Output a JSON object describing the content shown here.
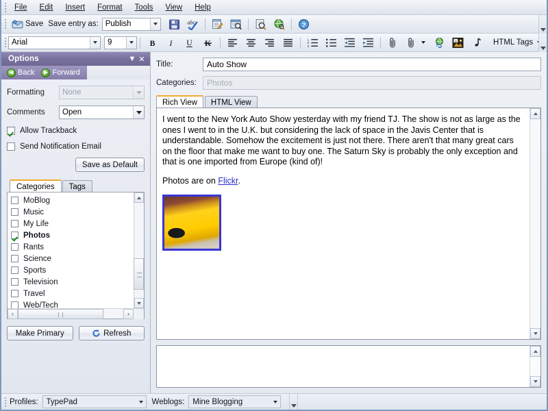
{
  "menu": {
    "items": [
      {
        "label": "File",
        "accel": "F"
      },
      {
        "label": "Edit",
        "accel": "E"
      },
      {
        "label": "Insert",
        "accel": "I"
      },
      {
        "label": "Format",
        "accel": "o"
      },
      {
        "label": "Tools",
        "accel": "T"
      },
      {
        "label": "View",
        "accel": "V"
      },
      {
        "label": "Help",
        "accel": "H"
      }
    ]
  },
  "toolbar_main": {
    "save_label": "Save",
    "save_entry_as_label": "Save entry as:",
    "publish_value": "Publish",
    "icons": [
      {
        "name": "save-disk-icon",
        "title": "Save"
      },
      {
        "name": "spellcheck-icon",
        "title": "Spelling"
      },
      {
        "name": "edit-note-icon",
        "title": "Edit"
      },
      {
        "name": "preview-window-icon",
        "title": "Preview"
      },
      {
        "name": "print-preview-icon",
        "title": "Print Preview"
      },
      {
        "name": "globe-search-icon",
        "title": "Open Weblog"
      },
      {
        "name": "help-icon",
        "title": "Help"
      }
    ]
  },
  "toolbar_format": {
    "font_family": "Arial",
    "font_size": "9",
    "html_tags_label": "HTML Tags",
    "buttons": [
      {
        "name": "bold-button",
        "glyph": "B"
      },
      {
        "name": "italic-button",
        "glyph": "I"
      },
      {
        "name": "underline-button",
        "glyph": "U"
      },
      {
        "name": "strikethrough-button",
        "glyph": "K"
      }
    ],
    "align_buttons": [
      "align-left",
      "align-center",
      "align-right",
      "align-justify"
    ],
    "list_buttons": [
      "ordered-list",
      "unordered-list",
      "outdent",
      "indent"
    ],
    "insert_buttons": [
      "attachment",
      "attachment-dropdown",
      "insert-link",
      "insert-image",
      "insert-audio"
    ]
  },
  "sidebar": {
    "panel_title": "Options",
    "collapse_icon": "chevron-down-icon",
    "close_icon": "close-icon",
    "nav": {
      "back_label": "Back",
      "forward_label": "Forward"
    },
    "formatting": {
      "label": "Formatting",
      "value": "None",
      "disabled": true
    },
    "comments": {
      "label": "Comments",
      "value": "Open",
      "disabled": false
    },
    "checkboxes": [
      {
        "label": "Allow Trackback",
        "checked": true,
        "name": "allow-trackback-checkbox"
      },
      {
        "label": "Send Notification Email",
        "checked": false,
        "name": "send-notification-email-checkbox"
      }
    ],
    "save_default_label": "Save as Default",
    "save_default_accel": "S",
    "tabs": [
      {
        "label": "Categories",
        "active": true
      },
      {
        "label": "Tags",
        "active": false
      }
    ],
    "categories": [
      {
        "label": "MoBlog",
        "checked": false,
        "bold": false
      },
      {
        "label": "Music",
        "checked": false,
        "bold": false
      },
      {
        "label": "My Life",
        "checked": false,
        "bold": false
      },
      {
        "label": "Photos",
        "checked": true,
        "bold": true
      },
      {
        "label": "Rants",
        "checked": false,
        "bold": false
      },
      {
        "label": "Science",
        "checked": false,
        "bold": false
      },
      {
        "label": "Sports",
        "checked": false,
        "bold": false
      },
      {
        "label": "Television",
        "checked": false,
        "bold": false
      },
      {
        "label": "Travel",
        "checked": false,
        "bold": false
      },
      {
        "label": "Web/Tech",
        "checked": false,
        "bold": false
      }
    ],
    "make_primary_label": "Make Primary",
    "make_primary_accel": "M",
    "refresh_label": "Refresh",
    "refresh_accel": "R"
  },
  "main": {
    "title_label": "Title:",
    "title_value": "Auto Show",
    "categories_label": "Categories:",
    "categories_value": "Photos",
    "view_tabs": [
      {
        "label": "Rich View",
        "active": true
      },
      {
        "label": "HTML View",
        "active": false
      }
    ],
    "entry": {
      "paragraph_1": "I went to the New York Auto Show yesterday with my friend TJ. The show is not as large as the ones I went to in the U.K. but considering the lack of space in the Javis Center that is understandable. Somehow the excitement is just not there. There aren't that many great cars on the floor that make me want to buy one. The Saturn Sky is probably the only exception and that is one imported from Europe (kind of)!",
      "paragraph_2_prefix": "Photos are on ",
      "paragraph_2_link": "Flickr",
      "paragraph_2_suffix": ".",
      "image_alt": "yellow-sports-car-photo"
    },
    "extended_entry_value": ""
  },
  "statusbar": {
    "profiles_label": "Profiles:",
    "profiles_value": "TypePad",
    "weblogs_label": "Weblogs:",
    "weblogs_value": "Mine Blogging"
  },
  "colors": {
    "panel_header_purple": "#7b739f",
    "tab_accent_orange": "#f0a830",
    "link_blue": "#2b2bd0",
    "image_border_blue": "#3a35d6",
    "window_border": "#7f99bd"
  }
}
